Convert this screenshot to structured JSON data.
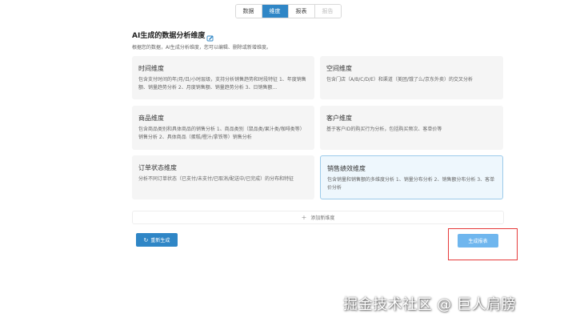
{
  "tabs": [
    {
      "label": "数据",
      "state": "normal"
    },
    {
      "label": "维度",
      "state": "active"
    },
    {
      "label": "报表",
      "state": "normal"
    },
    {
      "label": "报告",
      "state": "disabled"
    }
  ],
  "header": {
    "title": "AI生成的数据分析维度",
    "title_icon": "edit-icon",
    "subtitle": "根据您的数据，AI生成分析维度，您可以编辑、删除或新增维度。"
  },
  "cards": [
    {
      "title": "时间维度",
      "desc": "包含支付时间的年/月/日/小时层级，支持分析销售趋势和时段特征 1、年度销售额、销量趋势分析 2、月度销售额、销量趋势分析 3、日销售额..."
    },
    {
      "title": "空间维度",
      "desc": "包含门店（A/B/C/D/E）和渠道（美团/饿了么/京东外卖）的交叉分析"
    },
    {
      "title": "商品维度",
      "desc": "包含商品类别和具体商品的销售分析 1、商品类别（鼠品类/果汁类/咖啡类等）销售分析 2、具体商品（蛋糕/橙汁/拿铁等）销售分析"
    },
    {
      "title": "客户维度",
      "desc": "基于客户ID的购买行为分析，包括购买频次、客单价等"
    },
    {
      "title": "订单状态维度",
      "desc": "分析不同订单状态（已支付/未支付/已取消/配送中/已完成）的分布和特征"
    },
    {
      "title": "销售绩效维度",
      "desc": "包含销量和销售额的多维度分析 1、销量分布分析 2、销售额分布分析 3、客单价分析"
    }
  ],
  "add_row": {
    "icon": "plus-icon",
    "label": "添加新维度"
  },
  "buttons": {
    "regenerate": {
      "icon": "refresh-icon",
      "label": "重新生成"
    },
    "generate_report": {
      "label": "生成报表"
    }
  },
  "watermark": "掘金技术社区 @ 巨人肩膀",
  "colors": {
    "primary": "#2f86c6",
    "primary_light": "#6fb6ee",
    "highlight_box": "#e63a3a",
    "card_bg": "#f5f5f5",
    "selected_border": "#9ccbea"
  }
}
